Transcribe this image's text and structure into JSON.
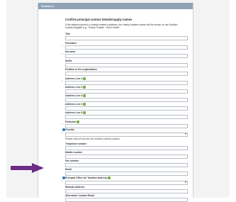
{
  "section_title": "Section A",
  "heading": "Confirm principal contact details/supply names",
  "intro": "If the address given is a charity trustee's address, the charity trustee's name will be shown on the Scottish Charity Register e.g. \"Clarity Trustee - Mrs A Smith\".",
  "fields": {
    "title": "Title",
    "forename": "Forename",
    "surname": "Surname",
    "suffix": "Suffix",
    "position": "Position in the organisation",
    "addr1": "Address Line 1",
    "addr2": "Address Line 2",
    "addr3": "Address Line 3",
    "addr4": "Address Line 4",
    "addr5": "Address Line 5",
    "postcode": "Postcode",
    "country": "Country",
    "phone_note": "Please enter phone and fax numbers without spaces.",
    "telephone": "Telephone number",
    "mobile": "Mobile number",
    "fax": "Fax number",
    "email": "Email",
    "principal_office": "Principal Office for Taxation Address",
    "website": "Website Address",
    "alt_contact_email": "Alternative Contact Email"
  },
  "required_marker": "*"
}
